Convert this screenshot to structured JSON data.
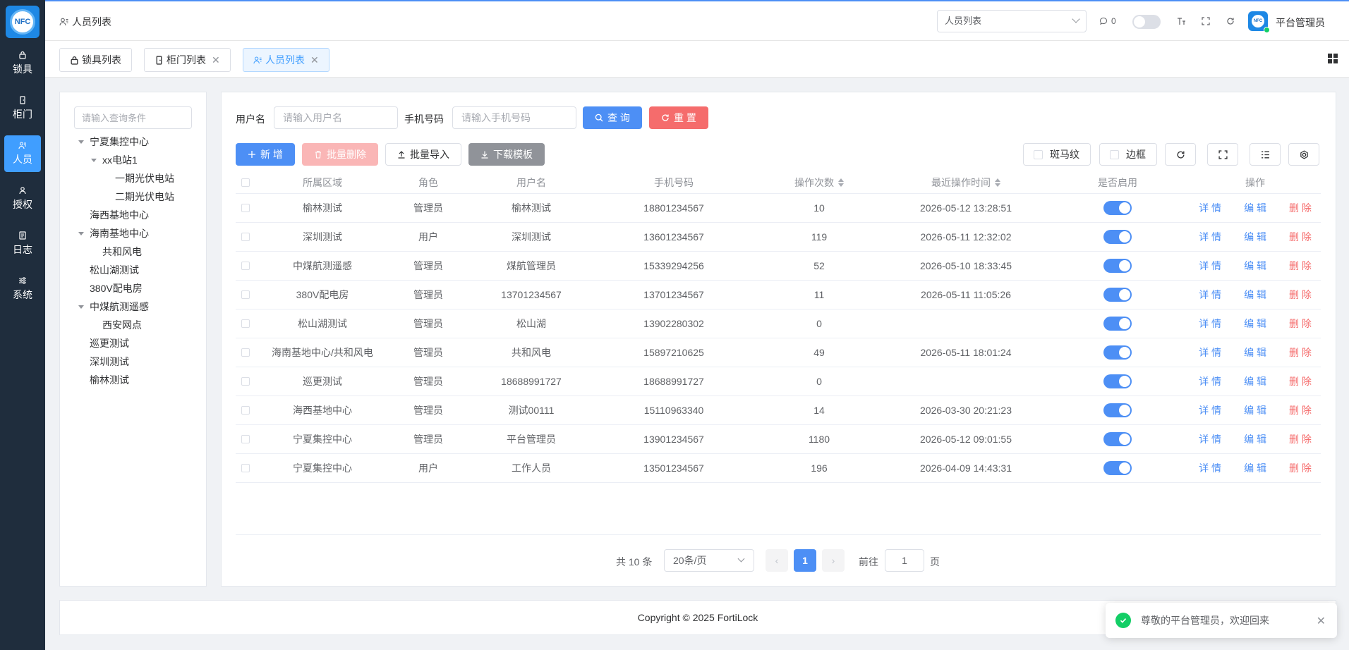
{
  "logo_text": "NFC",
  "sidebar": {
    "items": [
      {
        "label": "锁具",
        "icon": "lock-icon"
      },
      {
        "label": "柜门",
        "icon": "door-icon"
      },
      {
        "label": "人员",
        "icon": "users-icon",
        "active": true
      },
      {
        "label": "授权",
        "icon": "key-user-icon"
      },
      {
        "label": "日志",
        "icon": "log-icon"
      },
      {
        "label": "系统",
        "icon": "settings-sliders-icon"
      }
    ]
  },
  "header": {
    "breadcrumb": "人员列表",
    "menu_search_value": "人员列表",
    "message_count": "0",
    "user_name": "平台管理员",
    "avatar_text": "NFC"
  },
  "tabs": [
    {
      "label": "锁具列表",
      "closable": false
    },
    {
      "label": "柜门列表",
      "closable": true
    },
    {
      "label": "人员列表",
      "closable": true,
      "active": true
    }
  ],
  "tree": {
    "search_placeholder": "请输入查询条件",
    "nodes": [
      {
        "label": "宁夏集控中心",
        "level": 0,
        "expanded": true
      },
      {
        "label": "xx电站1",
        "level": 1,
        "expanded": true
      },
      {
        "label": "一期光伏电站",
        "level": 2
      },
      {
        "label": "二期光伏电站",
        "level": 2
      },
      {
        "label": "海西基地中心",
        "level": 0
      },
      {
        "label": "海南基地中心",
        "level": 0,
        "expanded": true
      },
      {
        "label": "共和风电",
        "level": 1
      },
      {
        "label": "松山湖测试",
        "level": 0
      },
      {
        "label": "380V配电房",
        "level": 0
      },
      {
        "label": "中煤航测遥感",
        "level": 0,
        "expanded": true
      },
      {
        "label": "西安网点",
        "level": 1
      },
      {
        "label": "巡更测试",
        "level": 0
      },
      {
        "label": "深圳测试",
        "level": 0
      },
      {
        "label": "榆林测试",
        "level": 0
      }
    ]
  },
  "search": {
    "username_label": "用户名",
    "username_placeholder": "请输入用户名",
    "phone_label": "手机号码",
    "phone_placeholder": "请输入手机号码",
    "query_label": "查 询",
    "reset_label": "重 置"
  },
  "toolbar": {
    "add_label": "新 增",
    "batch_delete_label": "批量删除",
    "batch_import_label": "批量导入",
    "download_template_label": "下载模板",
    "stripe_label": "斑马纹",
    "border_label": "边框"
  },
  "table": {
    "columns": [
      "所属区域",
      "角色",
      "用户名",
      "手机号码",
      "操作次数",
      "最近操作时间",
      "是否启用",
      "操作"
    ],
    "actions": {
      "detail": "详 情",
      "edit": "编 辑",
      "delete": "删 除"
    },
    "rows": [
      {
        "area": "榆林测试",
        "role": "管理员",
        "username": "榆林测试",
        "phone": "18801234567",
        "ops": "10",
        "last": "2026-05-12 13:28:51",
        "enabled": true
      },
      {
        "area": "深圳测试",
        "role": "用户",
        "username": "深圳测试",
        "phone": "13601234567",
        "ops": "119",
        "last": "2026-05-11 12:32:02",
        "enabled": true
      },
      {
        "area": "中煤航测遥感",
        "role": "管理员",
        "username": "煤航管理员",
        "phone": "15339294256",
        "ops": "52",
        "last": "2026-05-10 18:33:45",
        "enabled": true
      },
      {
        "area": "380V配电房",
        "role": "管理员",
        "username": "13701234567",
        "phone": "13701234567",
        "ops": "11",
        "last": "2026-05-11 11:05:26",
        "enabled": true
      },
      {
        "area": "松山湖测试",
        "role": "管理员",
        "username": "松山湖",
        "phone": "13902280302",
        "ops": "0",
        "last": "",
        "enabled": true
      },
      {
        "area": "海南基地中心/共和风电",
        "role": "管理员",
        "username": "共和风电",
        "phone": "15897210625",
        "ops": "49",
        "last": "2026-05-11 18:01:24",
        "enabled": true
      },
      {
        "area": "巡更测试",
        "role": "管理员",
        "username": "18688991727",
        "phone": "18688991727",
        "ops": "0",
        "last": "",
        "enabled": true
      },
      {
        "area": "海西基地中心",
        "role": "管理员",
        "username": "测试00111",
        "phone": "15110963340",
        "ops": "14",
        "last": "2026-03-30 20:21:23",
        "enabled": true
      },
      {
        "area": "宁夏集控中心",
        "role": "管理员",
        "username": "平台管理员",
        "phone": "13901234567",
        "ops": "1180",
        "last": "2026-05-12 09:01:55",
        "enabled": true
      },
      {
        "area": "宁夏集控中心",
        "role": "用户",
        "username": "工作人员",
        "phone": "13501234567",
        "ops": "196",
        "last": "2026-04-09 14:43:31",
        "enabled": true
      }
    ]
  },
  "pagination": {
    "total_text": "共 10 条",
    "page_size": "20条/页",
    "current_page": "1",
    "goto_label": "前往",
    "goto_value": "1",
    "page_suffix": "页"
  },
  "footer": {
    "copyright": "Copyright © 2025 FortiLock"
  },
  "toast": {
    "message": "尊敬的平台管理员，欢迎回来"
  },
  "colors": {
    "primary": "#4d8ff5",
    "danger": "#f56c6c",
    "sidebar": "#1f2d3d",
    "success": "#13ce66"
  }
}
